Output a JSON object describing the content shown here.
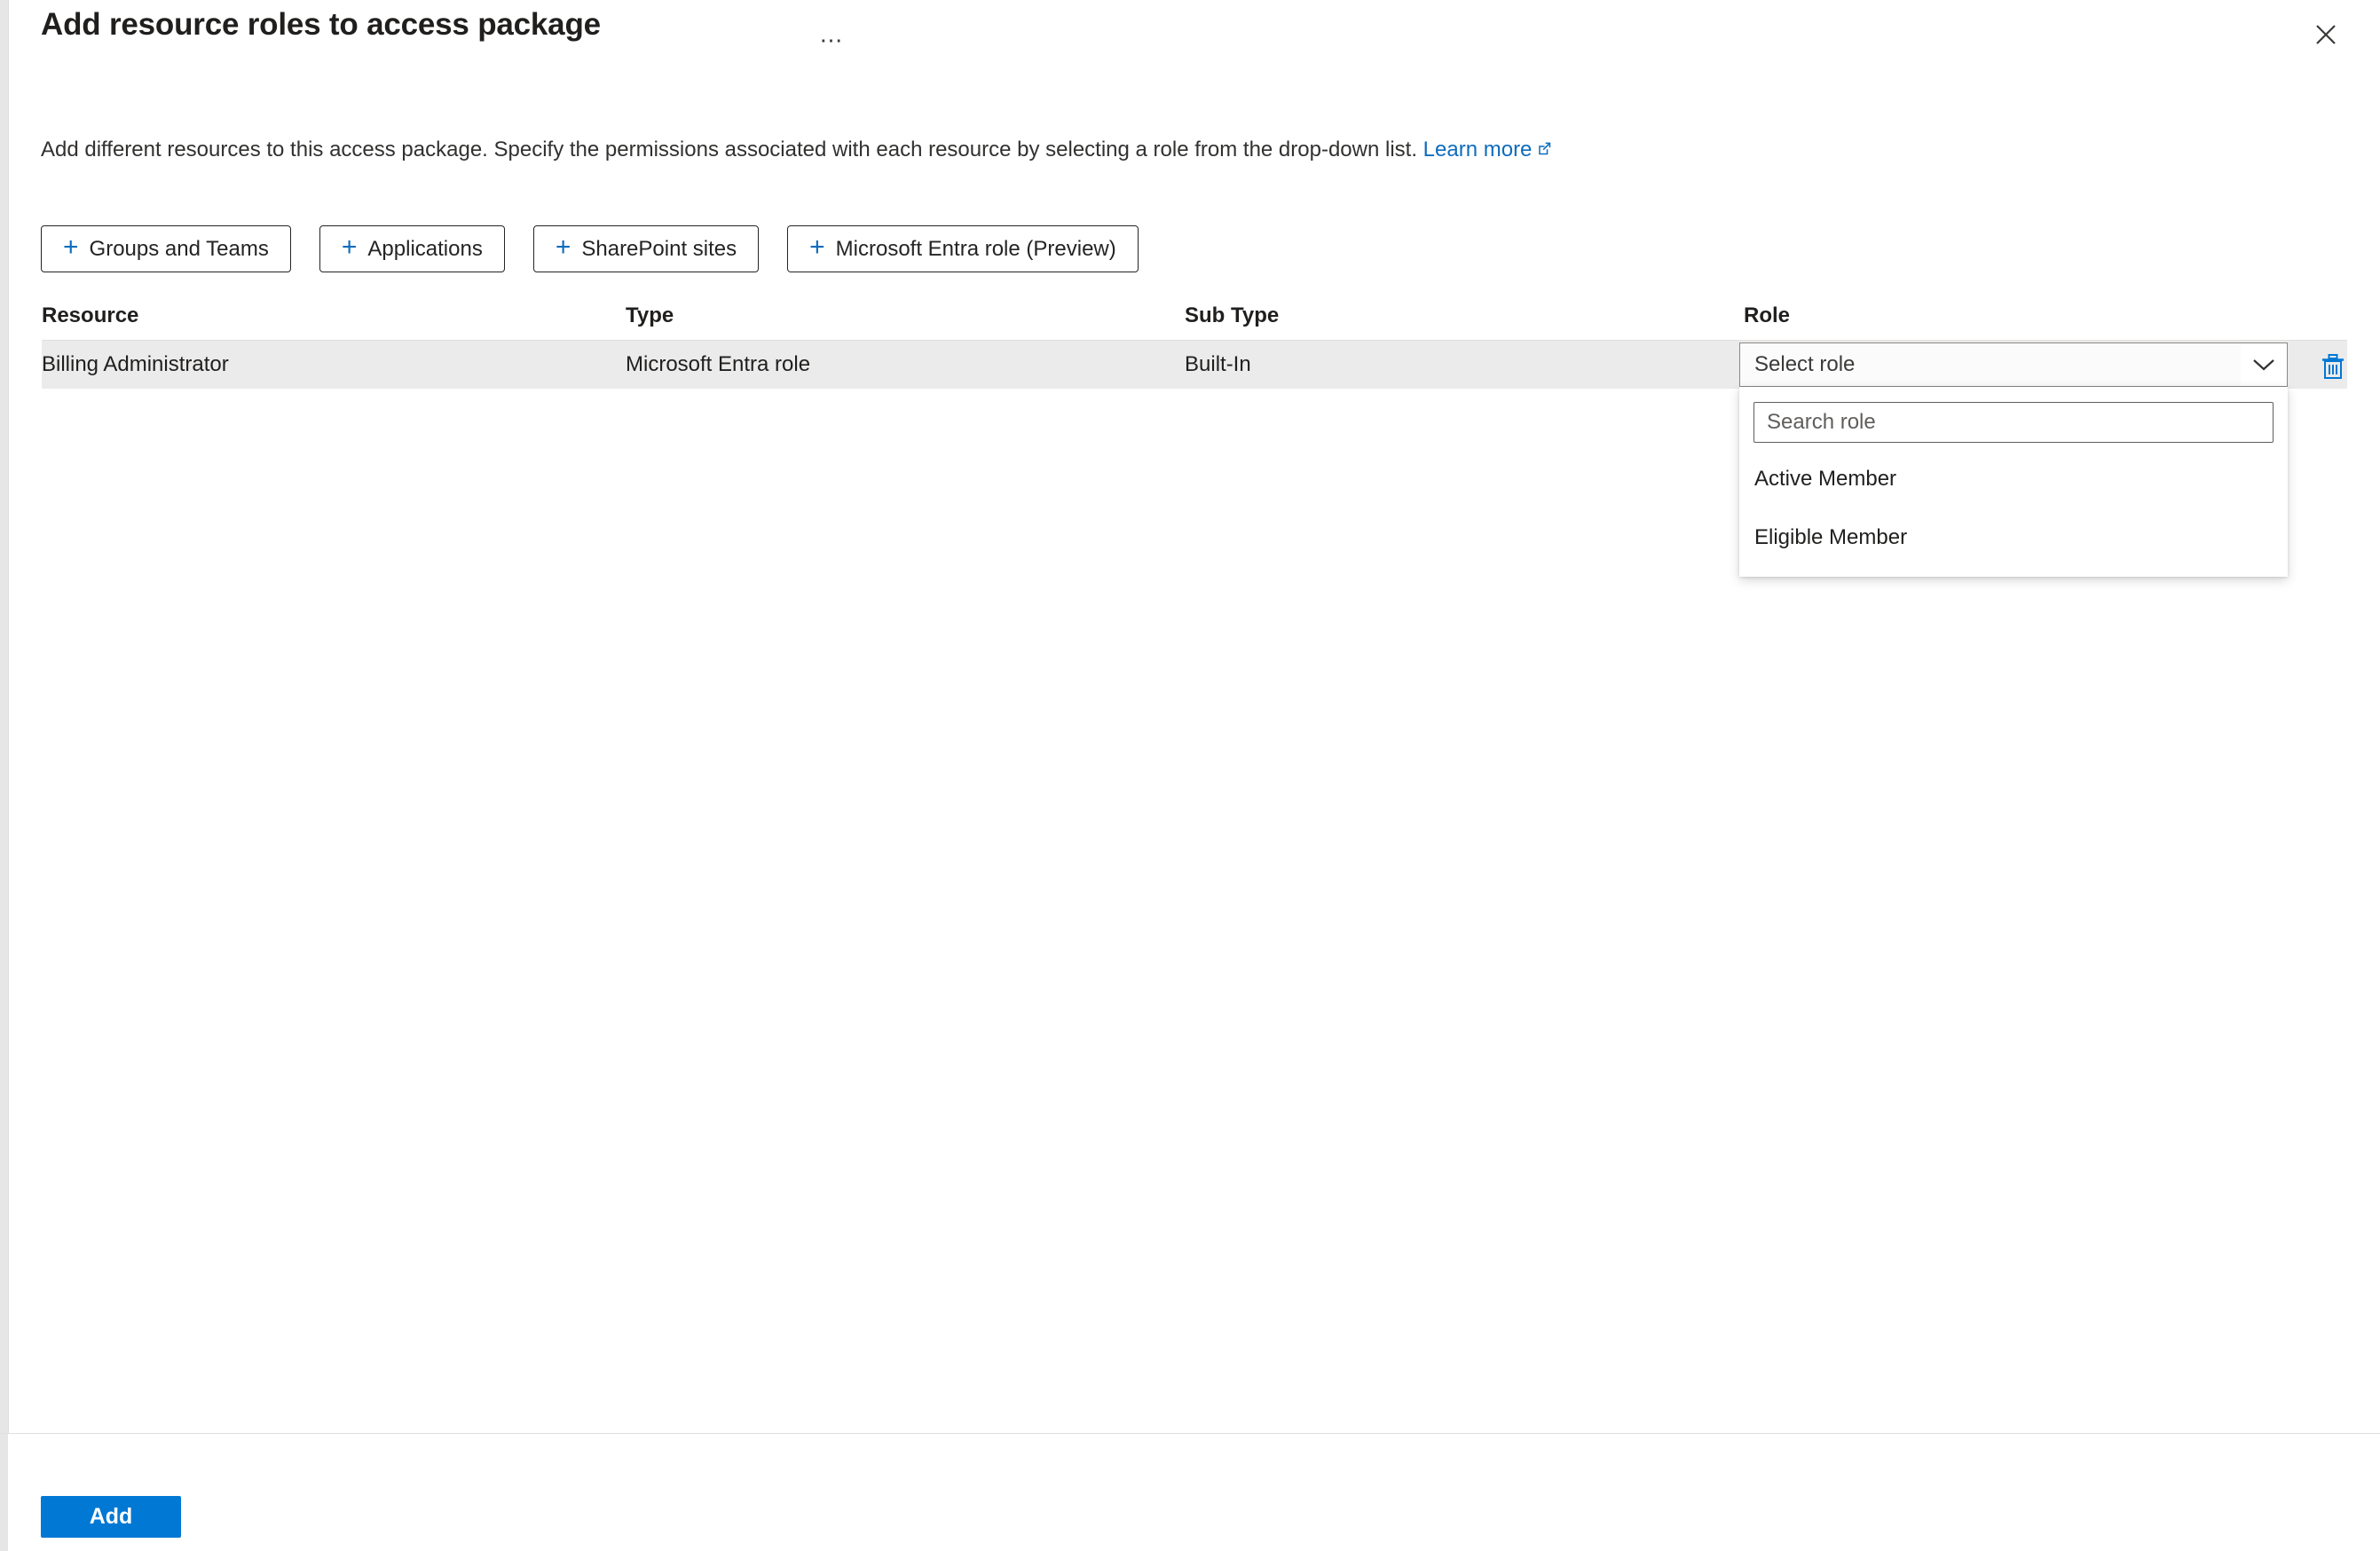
{
  "blade": {
    "title": "Add resource roles to access package",
    "context_menu_label": "…",
    "close_label": "Close",
    "close_icon": "close-icon",
    "context_menu_icon": "ellipsis-icon"
  },
  "description": {
    "text": "Add different resources to this access package. Specify the permissions associated with each resource by selecting a role from the drop-down list.",
    "link_label": "Learn more",
    "link_icon": "external-link-icon"
  },
  "add_resource_buttons": [
    {
      "label": "Groups and Teams",
      "icon": "plus-icon",
      "glyph": "+"
    },
    {
      "label": "Applications",
      "icon": "plus-icon",
      "glyph": "+"
    },
    {
      "label": "SharePoint sites",
      "icon": "plus-icon",
      "glyph": "+"
    },
    {
      "label": "Microsoft Entra role (Preview)",
      "icon": "plus-icon",
      "glyph": "+"
    }
  ],
  "table": {
    "columns": [
      "Resource",
      "Type",
      "Sub Type",
      "Role"
    ],
    "rows": [
      {
        "resource": "Billing Administrator",
        "type": "Microsoft Entra role",
        "sub_type": "Built-In",
        "role_selected": "Select role",
        "delete_icon": "trash-icon",
        "chevron_icon": "chevron-down-icon"
      }
    ]
  },
  "role_dropdown": {
    "open": true,
    "search_placeholder": "Search role",
    "search_value": "",
    "options": [
      "Active Member",
      "Eligible Member"
    ]
  },
  "footer": {
    "primary_button": "Add"
  },
  "colors": {
    "accent": "#0078d4",
    "link": "#0f6cbd",
    "row_background": "#ebebeb",
    "text": "#201f1e",
    "border": "#e1dfdd"
  }
}
